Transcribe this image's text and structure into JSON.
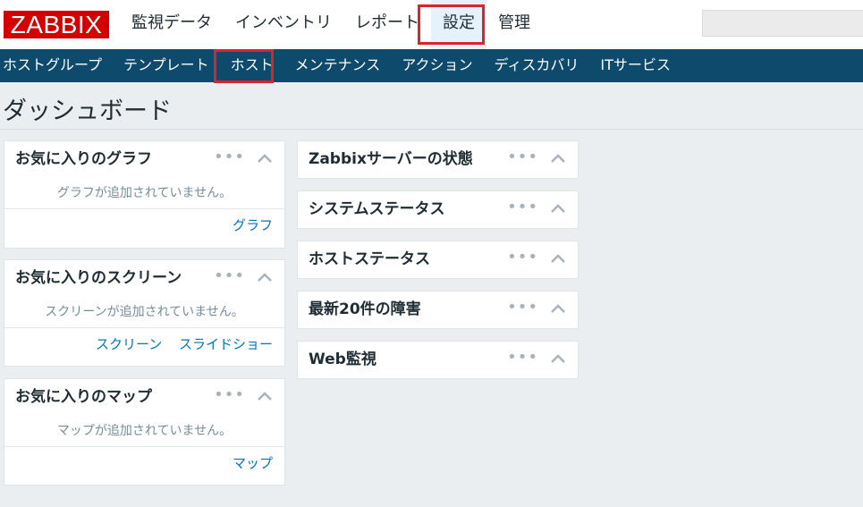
{
  "header": {
    "logo": "ZABBIX",
    "menu": [
      {
        "label": "監視データ"
      },
      {
        "label": "インベントリ"
      },
      {
        "label": "レポート"
      },
      {
        "label": "設定"
      },
      {
        "label": "管理"
      }
    ],
    "search": {
      "value": ""
    }
  },
  "subnav": {
    "items": [
      {
        "label": "ホストグループ"
      },
      {
        "label": "テンプレート"
      },
      {
        "label": "ホスト"
      },
      {
        "label": "メンテナンス"
      },
      {
        "label": "アクション"
      },
      {
        "label": "ディスカバリ"
      },
      {
        "label": "ITサービス"
      }
    ]
  },
  "page": {
    "title": "ダッシュボード"
  },
  "widget_controls": {
    "menu_glyph": "•••"
  },
  "left_widgets": [
    {
      "title": "お気に入りのグラフ",
      "empty_text": "グラフが追加されていません。",
      "links": [
        "グラフ"
      ]
    },
    {
      "title": "お気に入りのスクリーン",
      "empty_text": "スクリーンが追加されていません。",
      "links": [
        "スクリーン",
        "スライドショー"
      ]
    },
    {
      "title": "お気に入りのマップ",
      "empty_text": "マップが追加されていません。",
      "links": [
        "マップ"
      ]
    }
  ],
  "right_widgets": [
    {
      "title": "Zabbixサーバーの状態"
    },
    {
      "title": "システムステータス"
    },
    {
      "title": "ホストステータス"
    },
    {
      "title": "最新20件の障害"
    },
    {
      "title": "Web監視"
    }
  ],
  "colors": {
    "brand_red": "#d40000",
    "nav_bg": "#0e4a6c",
    "highlight": "#d9232d",
    "link": "#0275b8"
  }
}
